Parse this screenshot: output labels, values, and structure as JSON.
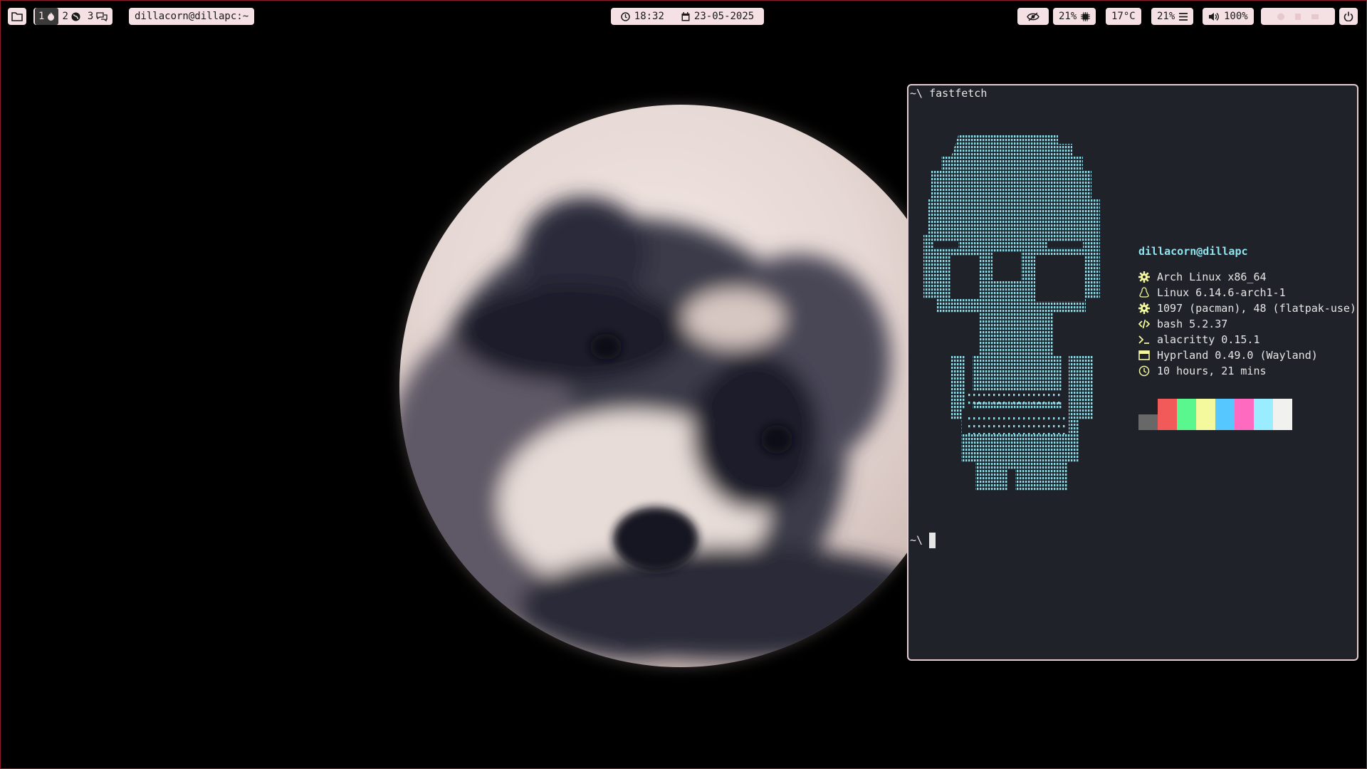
{
  "desktop": {
    "user_host_label": "dillacorn@dillapc:~",
    "workspaces": [
      {
        "number": "1",
        "icon": "flame-icon",
        "active": true
      },
      {
        "number": "2",
        "icon": "globe-icon",
        "active": false
      },
      {
        "number": "3",
        "icon": "chat-icon",
        "active": false
      }
    ],
    "clock": {
      "time": "18:32",
      "date": "23-05-2025"
    },
    "status": {
      "cpu": "21%",
      "temperature": "17°C",
      "memory": "21%",
      "volume": "100%"
    }
  },
  "terminal": {
    "command_prompt": "~\\",
    "command": "fastfetch",
    "final_prompt": "~\\",
    "fastfetch": {
      "title": "dillacorn@dillapc",
      "rows": [
        {
          "icon": "gear-icon",
          "text": "Arch Linux x86_64"
        },
        {
          "icon": "linux-icon",
          "text": "Linux 6.14.6-arch1-1"
        },
        {
          "icon": "gear-icon",
          "text": "1097 (pacman), 48 (flatpak-use)"
        },
        {
          "icon": "code-icon",
          "text": "bash 5.2.37"
        },
        {
          "icon": "terminal-icon",
          "text": "alacritty 0.15.1"
        },
        {
          "icon": "window-icon",
          "text": "Hyprland 0.49.0 (Wayland)"
        },
        {
          "icon": "clock-icon",
          "text": "10 hours, 21 mins"
        }
      ],
      "palette_top": [
        "#1f2229",
        "#f25a5a",
        "#5af78e",
        "#f4f99d",
        "#57c7ff",
        "#ff6ac1",
        "#9aedfe",
        "#f1f1f0"
      ],
      "palette_bottom": [
        "#686868",
        "#f25a5a",
        "#5af78e",
        "#f4f99d",
        "#57c7ff",
        "#ff6ac1",
        "#9aedfe",
        "#f1f1f0"
      ],
      "text_color": "#e6e6e6",
      "title_color": "#8fe4ef",
      "icon_color": "#f4f99d",
      "logo_color": "#8fdce8"
    }
  },
  "colors": {
    "bar_pill": "#f5e1e3",
    "window_border": "#e4ccd0",
    "terminal_bg": "#1f2229"
  }
}
